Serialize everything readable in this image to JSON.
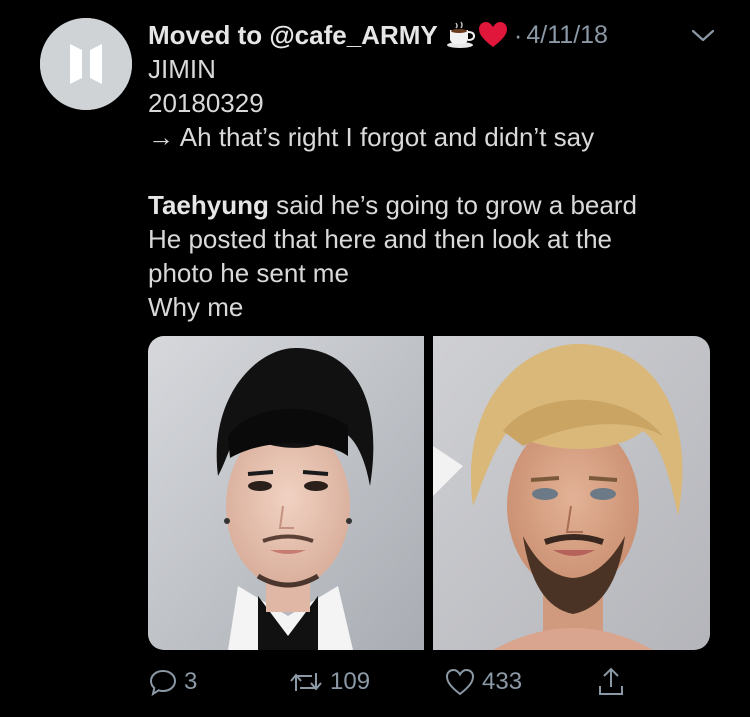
{
  "tweet": {
    "display_name": "Moved to @cafe_ARMY",
    "name_emoji": [
      "hot-beverage-emoji",
      "red-heart-emoji"
    ],
    "separator": "·",
    "timestamp": "4/11/18",
    "avatar_icon": "bts-logo-icon",
    "lines": {
      "l1": "JIMIN",
      "l2": "20180329",
      "l3": "→ Ah that’s right I forgot and didn’t say",
      "l4_bold": "Taehyung",
      "l4_rest": " said he’s going to grow a beard",
      "l5": "He posted that here and then look at the",
      "l6": "photo he sent me",
      "l7": "Why me"
    },
    "media": [
      {
        "name": "photo-left",
        "description_icon": "person-photo"
      },
      {
        "name": "photo-right",
        "description_icon": "person-photo-edited"
      }
    ],
    "actions": {
      "reply_count": "3",
      "retweet_count": "109",
      "like_count": "433",
      "reply_icon": "reply-icon",
      "retweet_icon": "retweet-icon",
      "like_icon": "heart-icon",
      "share_icon": "share-icon"
    }
  },
  "colors": {
    "background": "#000000",
    "text": "#d9d9d9",
    "secondary": "#8b98a5"
  }
}
